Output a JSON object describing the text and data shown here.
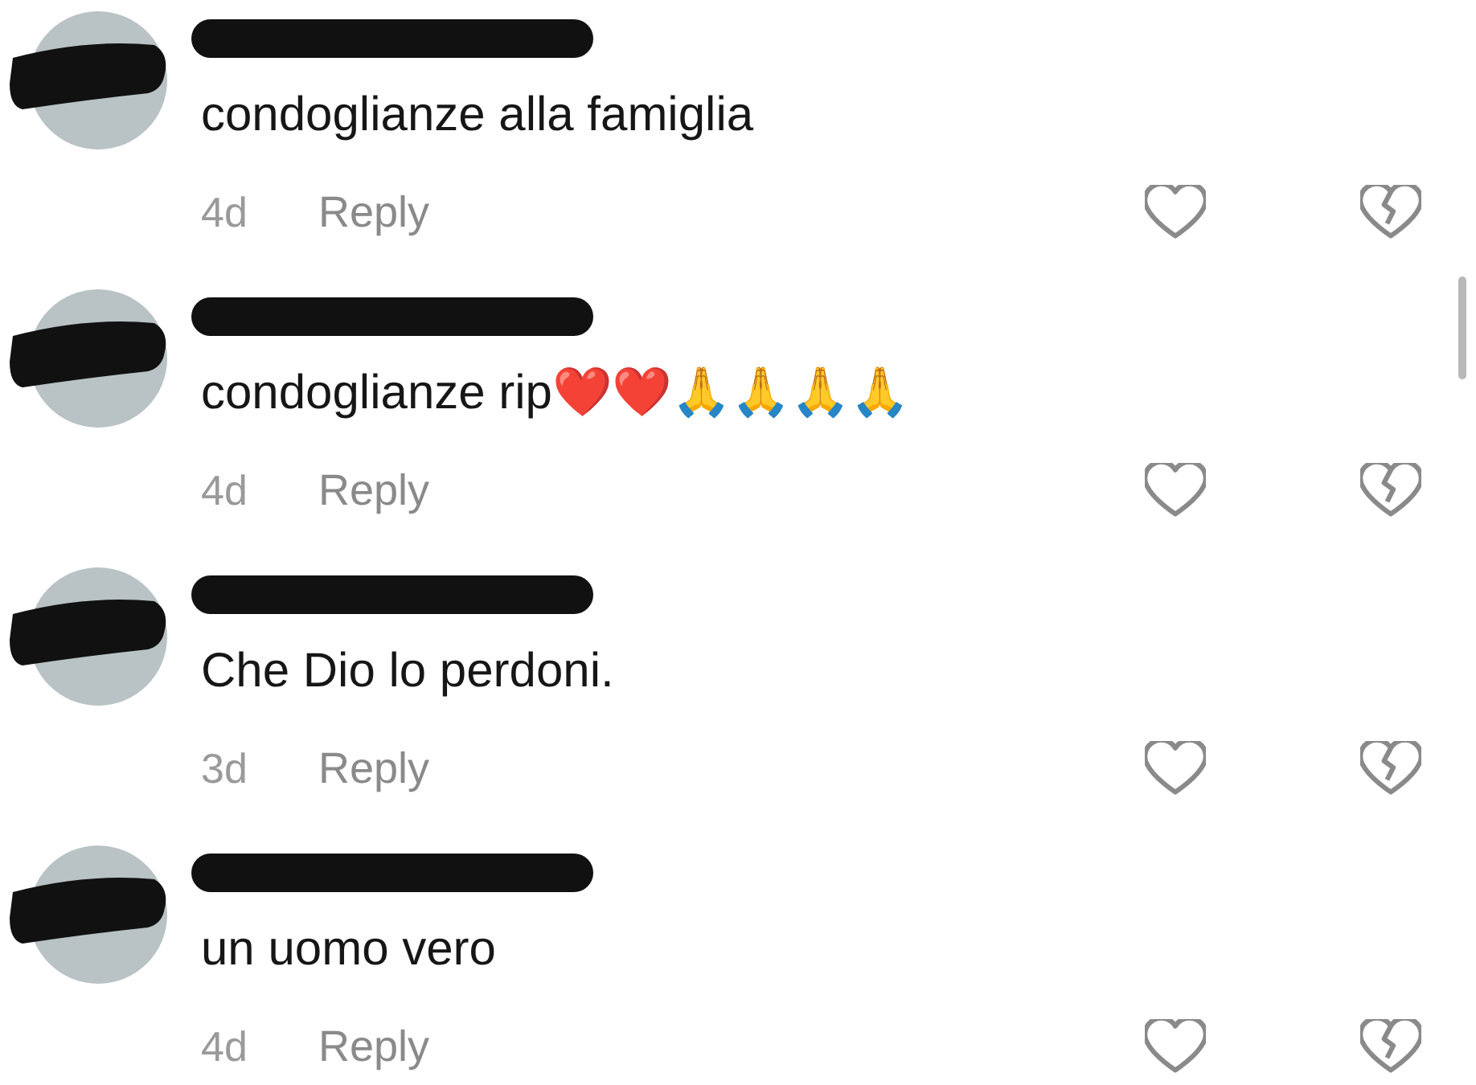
{
  "comments": [
    {
      "text": "condoglianze alla famiglia",
      "age": "4d",
      "reply": "Reply"
    },
    {
      "text": "condoglianze rip❤️❤️🙏🙏🙏🙏",
      "age": "4d",
      "reply": "Reply"
    },
    {
      "text": "Che Dio lo perdoni.",
      "age": "3d",
      "reply": "Reply"
    },
    {
      "text": "un uomo vero",
      "age": "4d",
      "reply": "Reply"
    }
  ]
}
